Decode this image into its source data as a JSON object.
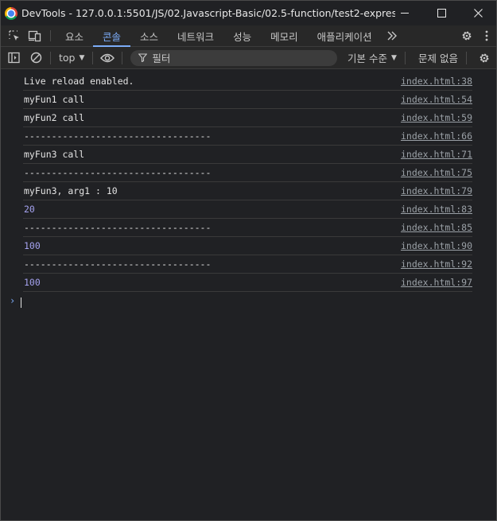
{
  "window": {
    "title": "DevTools - 127.0.0.1:5501/JS/02.Javascript-Basic/02.5-function/test2-expression-fun..."
  },
  "tabs": [
    {
      "label": "요소"
    },
    {
      "label": "콘솔"
    },
    {
      "label": "소스"
    },
    {
      "label": "네트워크"
    },
    {
      "label": "성능"
    },
    {
      "label": "메모리"
    },
    {
      "label": "애플리케이션"
    }
  ],
  "toolbar": {
    "context": "top",
    "filter_placeholder": "필터",
    "levels": "기본 수준",
    "issues": "문제 없음"
  },
  "console": {
    "messages": [
      {
        "text": "Live reload enabled.",
        "source": "index.html:38",
        "type": "log"
      },
      {
        "text": "myFun1 call",
        "source": "index.html:54",
        "type": "log"
      },
      {
        "text": "myFun2 call",
        "source": "index.html:59",
        "type": "log"
      },
      {
        "text": "----------------------------------",
        "source": "index.html:66",
        "type": "log"
      },
      {
        "text": "myFun3 call",
        "source": "index.html:71",
        "type": "log"
      },
      {
        "text": "----------------------------------",
        "source": "index.html:75",
        "type": "log"
      },
      {
        "text": "myFun3, arg1 : 10",
        "source": "index.html:79",
        "type": "log"
      },
      {
        "text": "20",
        "source": "index.html:83",
        "type": "number"
      },
      {
        "text": "----------------------------------",
        "source": "index.html:85",
        "type": "log"
      },
      {
        "text": "100",
        "source": "index.html:90",
        "type": "number"
      },
      {
        "text": "----------------------------------",
        "source": "index.html:92",
        "type": "log"
      },
      {
        "text": "100",
        "source": "index.html:97",
        "type": "number"
      }
    ]
  },
  "colors": {
    "accent": "#7cacf8",
    "number": "#a5a3f0",
    "background": "#202124"
  }
}
